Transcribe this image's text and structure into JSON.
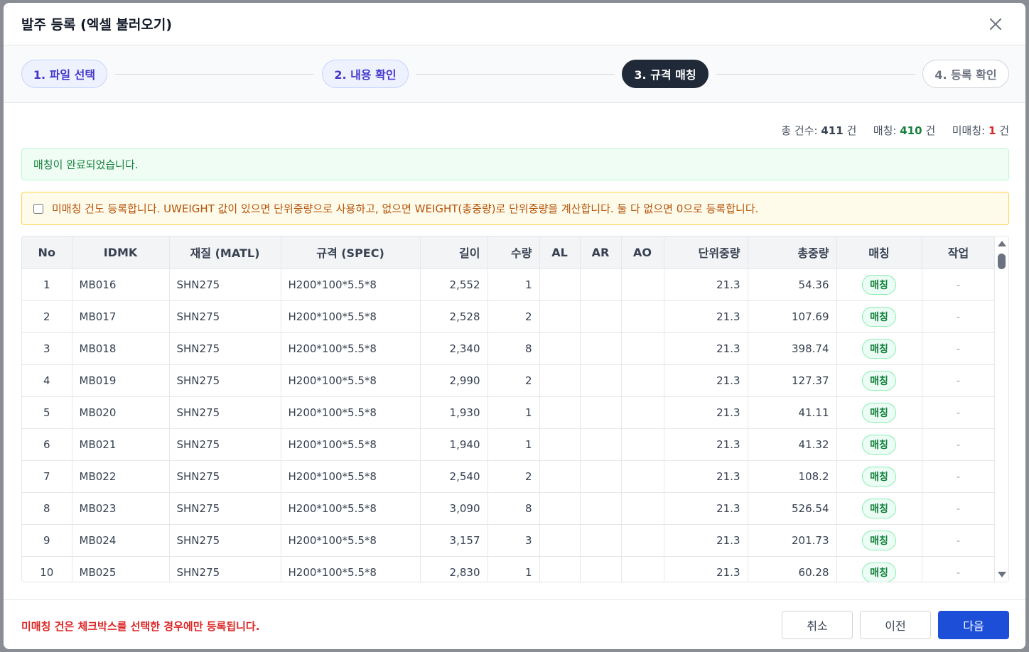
{
  "modal": {
    "title": "발주 등록 (엑셀 불러오기)"
  },
  "steps": [
    {
      "label": "1. 파일 선택",
      "state": "done"
    },
    {
      "label": "2. 내용 확인",
      "state": "done"
    },
    {
      "label": "3. 규격 매칭",
      "state": "active"
    },
    {
      "label": "4. 등록 확인",
      "state": "todo"
    }
  ],
  "summary": {
    "total_label": "총 건수:",
    "total": "411",
    "matched_label": "매칭:",
    "matched": "410",
    "unmatched_label": "미매칭:",
    "unmatched": "1",
    "unit": "건"
  },
  "alerts": {
    "success": "매칭이 완료되었습니다.",
    "warning": "미매칭 건도 등록합니다. UWEIGHT 값이 있으면 단위중량으로 사용하고, 없으면 WEIGHT(총중량)로 단위중량을 계산합니다. 둘 다 없으면 0으로 등록합니다.",
    "warning_checked": false
  },
  "table": {
    "columns": [
      "No",
      "IDMK",
      "재질 (MATL)",
      "규격 (SPEC)",
      "길이",
      "수량",
      "AL",
      "AR",
      "AO",
      "단위중량",
      "총중량",
      "매칭",
      "작업"
    ],
    "rows": [
      {
        "no": "1",
        "idmk": "MB016",
        "matl": "SHN275",
        "spec": "H200*100*5.5*8",
        "len": "2,552",
        "qty": "1",
        "al": "",
        "ar": "",
        "ao": "",
        "uw": "21.3",
        "tw": "54.36",
        "match": "매칭",
        "action": "-"
      },
      {
        "no": "2",
        "idmk": "MB017",
        "matl": "SHN275",
        "spec": "H200*100*5.5*8",
        "len": "2,528",
        "qty": "2",
        "al": "",
        "ar": "",
        "ao": "",
        "uw": "21.3",
        "tw": "107.69",
        "match": "매칭",
        "action": "-"
      },
      {
        "no": "3",
        "idmk": "MB018",
        "matl": "SHN275",
        "spec": "H200*100*5.5*8",
        "len": "2,340",
        "qty": "8",
        "al": "",
        "ar": "",
        "ao": "",
        "uw": "21.3",
        "tw": "398.74",
        "match": "매칭",
        "action": "-"
      },
      {
        "no": "4",
        "idmk": "MB019",
        "matl": "SHN275",
        "spec": "H200*100*5.5*8",
        "len": "2,990",
        "qty": "2",
        "al": "",
        "ar": "",
        "ao": "",
        "uw": "21.3",
        "tw": "127.37",
        "match": "매칭",
        "action": "-"
      },
      {
        "no": "5",
        "idmk": "MB020",
        "matl": "SHN275",
        "spec": "H200*100*5.5*8",
        "len": "1,930",
        "qty": "1",
        "al": "",
        "ar": "",
        "ao": "",
        "uw": "21.3",
        "tw": "41.11",
        "match": "매칭",
        "action": "-"
      },
      {
        "no": "6",
        "idmk": "MB021",
        "matl": "SHN275",
        "spec": "H200*100*5.5*8",
        "len": "1,940",
        "qty": "1",
        "al": "",
        "ar": "",
        "ao": "",
        "uw": "21.3",
        "tw": "41.32",
        "match": "매칭",
        "action": "-"
      },
      {
        "no": "7",
        "idmk": "MB022",
        "matl": "SHN275",
        "spec": "H200*100*5.5*8",
        "len": "2,540",
        "qty": "2",
        "al": "",
        "ar": "",
        "ao": "",
        "uw": "21.3",
        "tw": "108.2",
        "match": "매칭",
        "action": "-"
      },
      {
        "no": "8",
        "idmk": "MB023",
        "matl": "SHN275",
        "spec": "H200*100*5.5*8",
        "len": "3,090",
        "qty": "8",
        "al": "",
        "ar": "",
        "ao": "",
        "uw": "21.3",
        "tw": "526.54",
        "match": "매칭",
        "action": "-"
      },
      {
        "no": "9",
        "idmk": "MB024",
        "matl": "SHN275",
        "spec": "H200*100*5.5*8",
        "len": "3,157",
        "qty": "3",
        "al": "",
        "ar": "",
        "ao": "",
        "uw": "21.3",
        "tw": "201.73",
        "match": "매칭",
        "action": "-"
      },
      {
        "no": "10",
        "idmk": "MB025",
        "matl": "SHN275",
        "spec": "H200*100*5.5*8",
        "len": "2,830",
        "qty": "1",
        "al": "",
        "ar": "",
        "ao": "",
        "uw": "21.3",
        "tw": "60.28",
        "match": "매칭",
        "action": "-"
      }
    ]
  },
  "footer": {
    "note": "미매칭 건은 체크박스를 선택한 경우에만 등록됩니다.",
    "cancel_label": "취소",
    "prev_label": "이전",
    "next_label": "다음"
  },
  "icons": {
    "close": "close-icon"
  },
  "colors": {
    "primary": "#1d4ed8",
    "active_step": "#1f2937",
    "success": "#15803d",
    "danger": "#dc2626",
    "warning": "#b45309"
  }
}
